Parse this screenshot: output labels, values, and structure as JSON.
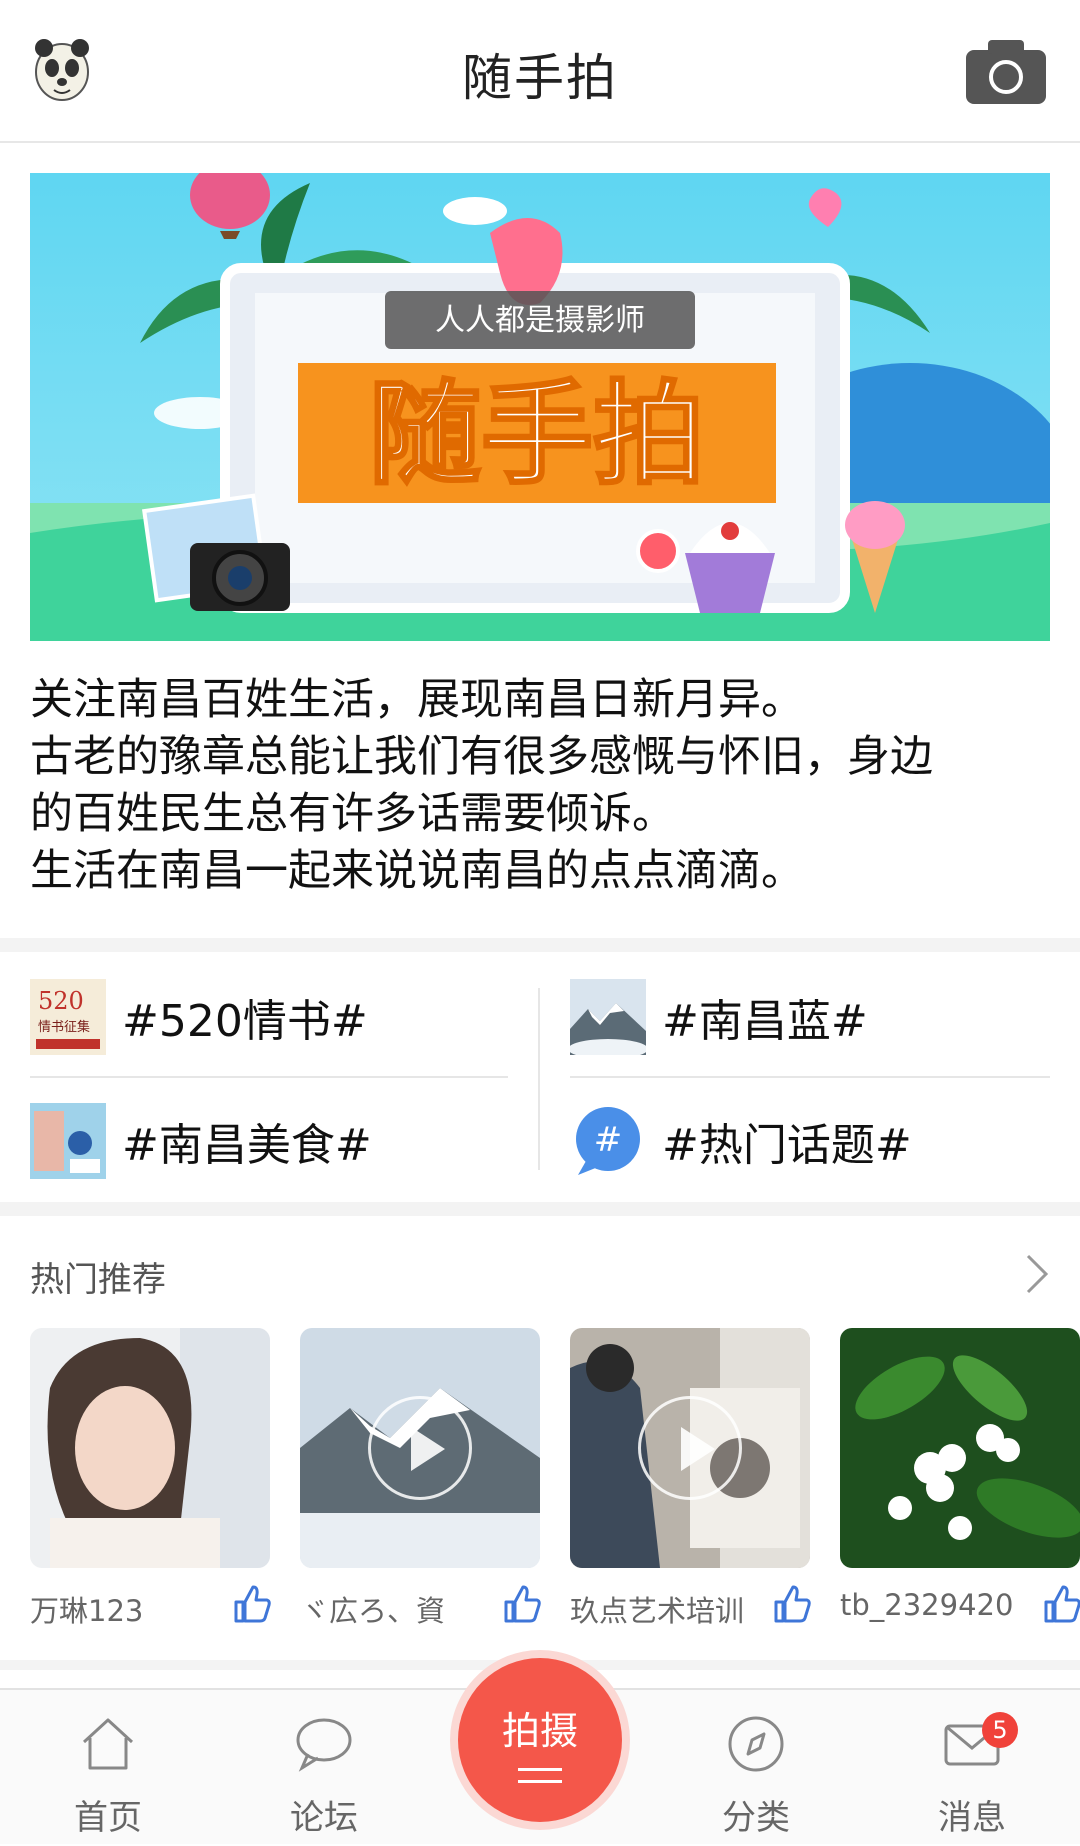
{
  "header": {
    "title": "随手拍",
    "avatar_icon": "panda-avatar-icon",
    "camera_icon": "camera-icon"
  },
  "banner": {
    "tagline": "人人都是摄影师",
    "title": "随手拍"
  },
  "intro": {
    "lines": [
      "关注南昌百姓生活，展现南昌日新月异。",
      "古老的豫章总能让我们有很多感慨与怀旧，身边",
      "的百姓民生总有许多话需要倾诉。",
      "生活在南昌一起来说说南昌的点点滴滴。"
    ]
  },
  "topics": [
    {
      "label": "#520情书#",
      "thumb_text": "520",
      "thumb_sub": "情书征集"
    },
    {
      "label": "#南昌蓝#"
    },
    {
      "label": "#南昌美食#"
    },
    {
      "label": "#热门话题#",
      "icon_glyph": "#"
    }
  ],
  "hot": {
    "title": "热门推荐",
    "items": [
      {
        "name": "万琳123",
        "video": false
      },
      {
        "name": "ヾ広ろ、資",
        "video": true
      },
      {
        "name": "玖点艺术培训",
        "video": true
      },
      {
        "name": "tb_2329420",
        "video": false
      }
    ]
  },
  "nav": {
    "home": "首页",
    "forum": "论坛",
    "shoot": "拍摄",
    "category": "分类",
    "messages": "消息",
    "badge": "5"
  },
  "colors": {
    "accent": "#f4574a",
    "like_blue": "#3f76d8",
    "banner_orange": "#f7931e",
    "banner_sky": "#56d3f0"
  }
}
